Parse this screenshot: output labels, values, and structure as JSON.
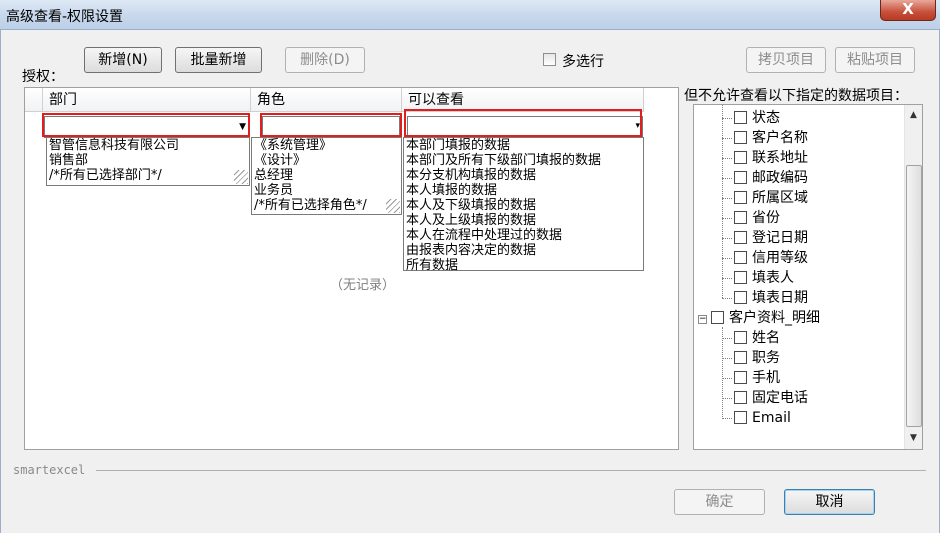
{
  "window": {
    "title": "高级查看-权限设置",
    "close_label": "X"
  },
  "toolbar": {
    "add_label": "新增(N)",
    "batch_add_label": "批量新增",
    "delete_label": "删除(D)",
    "multi_select_label": "多选行",
    "copy_label": "拷贝项目",
    "paste_label": "粘贴项目"
  },
  "auth_label": "授权：",
  "grid": {
    "columns": [
      "部门",
      "角色",
      "可以查看"
    ],
    "empty_text": "（无记录）",
    "dept_options": [
      "智管信息科技有限公司",
      "销售部",
      "/*所有已选择部门*/"
    ],
    "role_options": [
      "《系统管理》",
      "《设计》",
      "总经理",
      "业务员",
      "/*所有已选择角色*/"
    ],
    "view_options": [
      "本部门填报的数据",
      "本部门及所有下级部门填报的数据",
      "本分支机构填报的数据",
      "本人填报的数据",
      "本人及下级填报的数据",
      "本人及上级填报的数据",
      "本人在流程中处理过的数据",
      "由报表内容决定的数据",
      "所有数据"
    ]
  },
  "tree": {
    "heading": "但不允许查看以下指定的数据项目：",
    "items_a": [
      "状态",
      "客户名称",
      "联系地址",
      "邮政编码",
      "所属区域",
      "省份",
      "登记日期",
      "信用等级",
      "填表人",
      "填表日期"
    ],
    "group": "客户资料_明细",
    "items_b": [
      "姓名",
      "职务",
      "手机",
      "固定电话",
      "Email"
    ],
    "expand_symbol": "−"
  },
  "footer": {
    "brand": "smartexcel",
    "ok_label": "确定",
    "cancel_label": "取消"
  }
}
